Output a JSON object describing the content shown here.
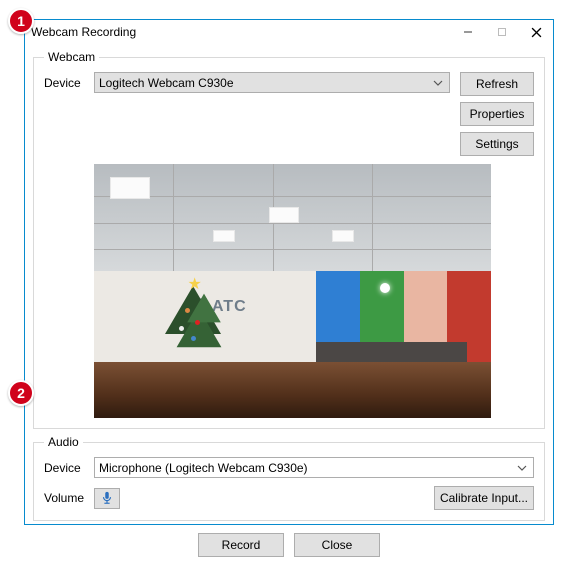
{
  "window": {
    "title": "Webcam Recording"
  },
  "webcam": {
    "legend": "Webcam",
    "deviceLabel": "Device",
    "deviceValue": "Logitech Webcam C930e",
    "buttons": {
      "refresh": "Refresh",
      "properties": "Properties",
      "settings": "Settings"
    },
    "preview": {
      "logoText": "ATC"
    }
  },
  "audio": {
    "legend": "Audio",
    "deviceLabel": "Device",
    "deviceValue": "Microphone (Logitech Webcam C930e)",
    "volumeLabel": "Volume",
    "calibrate": "Calibrate Input..."
  },
  "footer": {
    "record": "Record",
    "close": "Close"
  },
  "annotations": {
    "b1": "1",
    "b2": "2"
  }
}
